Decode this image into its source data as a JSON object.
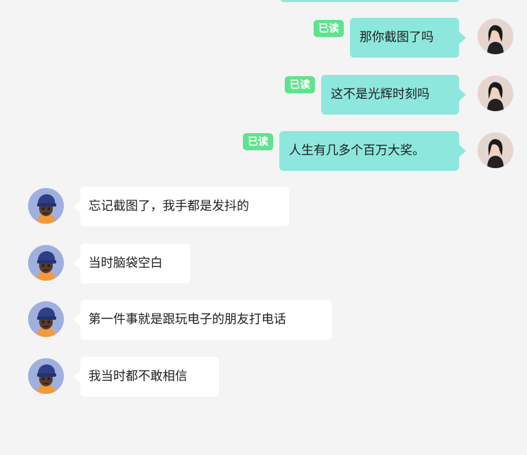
{
  "colors": {
    "background": "#f4f4f4",
    "outgoing_bubble": "#8de7dd",
    "incoming_bubble": "#ffffff",
    "read_badge": "#5fe38f"
  },
  "outgoing_messages": [
    {
      "text": "那你截图了吗",
      "read_label": "已读",
      "avatar_icon": "woman-portrait-icon"
    },
    {
      "text": "这不是光辉时刻吗",
      "read_label": "已读",
      "avatar_icon": "woman-portrait-icon"
    },
    {
      "text": "人生有几多个百万大奖。",
      "read_label": "已读",
      "avatar_icon": "woman-portrait-icon"
    }
  ],
  "incoming_messages": [
    {
      "text": "忘记截图了，我手都是发抖的",
      "avatar_icon": "man-with-cap-avatar-icon"
    },
    {
      "text": "当时脑袋空白",
      "avatar_icon": "man-with-cap-avatar-icon"
    },
    {
      "text": "第一件事就是跟玩电子的朋友打电话",
      "avatar_icon": "man-with-cap-avatar-icon"
    },
    {
      "text": "我当时都不敢相信",
      "avatar_icon": "man-with-cap-avatar-icon"
    }
  ]
}
